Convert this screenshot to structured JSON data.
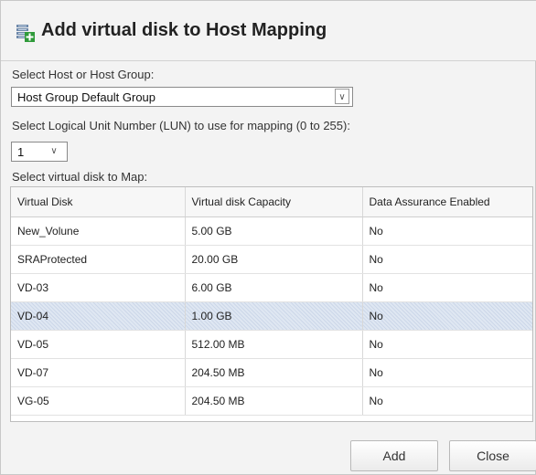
{
  "dialog": {
    "title": "Add virtual disk to Host Mapping",
    "title_icon": "disk-mapping-icon"
  },
  "host": {
    "label": "Select Host or Host Group:",
    "selected": "Host Group Default Group"
  },
  "lun": {
    "label": "Select Logical Unit Number (LUN) to use for mapping (0 to 255):",
    "selected": "1"
  },
  "disk_select": {
    "label": "Select virtual disk to Map:"
  },
  "table": {
    "headers": [
      "Virtual Disk",
      "Virtual disk Capacity",
      "Data Assurance Enabled"
    ],
    "rows": [
      [
        "New_Volune",
        "5.00 GB",
        "No"
      ],
      [
        "SRAProtected",
        "20.00 GB",
        "No"
      ],
      [
        "VD-03",
        "6.00 GB",
        "No"
      ],
      [
        "VD-04",
        "1.00 GB",
        "No"
      ],
      [
        "VD-05",
        "512.00 MB",
        "No"
      ],
      [
        "VD-07",
        "204.50 MB",
        "No"
      ],
      [
        "VG-05",
        "204.50 MB",
        "No"
      ]
    ],
    "selected_row": "VD-04"
  },
  "buttons": {
    "add": "Add",
    "close": "Close"
  }
}
